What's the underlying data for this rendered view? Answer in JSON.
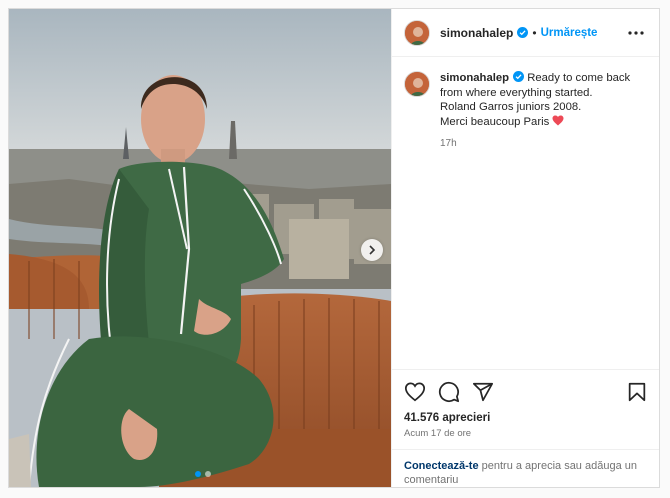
{
  "post": {
    "username": "simonahalep",
    "follow_label": "Urmărește",
    "separator": "•",
    "caption_lines": [
      "Ready to come back from where everything started.",
      "Roland Garros juniors 2008.",
      "Merci beaucoup Paris"
    ],
    "caption_time": "17h",
    "likes": "41.576 aprecieri",
    "posted_ago": "Acum 17 de ore",
    "login_link": "Conectează-te",
    "login_text": " pentru a aprecia sau adăuga un comentariu"
  },
  "carousel": {
    "total": 2,
    "current": 1
  },
  "icons": {
    "more": "more-options-icon",
    "like": "heart-icon",
    "comment": "comment-icon",
    "share": "share-icon",
    "save": "bookmark-icon",
    "verified": "verified-badge-icon",
    "next": "chevron-right-icon"
  },
  "colors": {
    "accent": "#0095f6",
    "heart": "#ed4956",
    "text": "#262626",
    "muted": "#737373"
  }
}
